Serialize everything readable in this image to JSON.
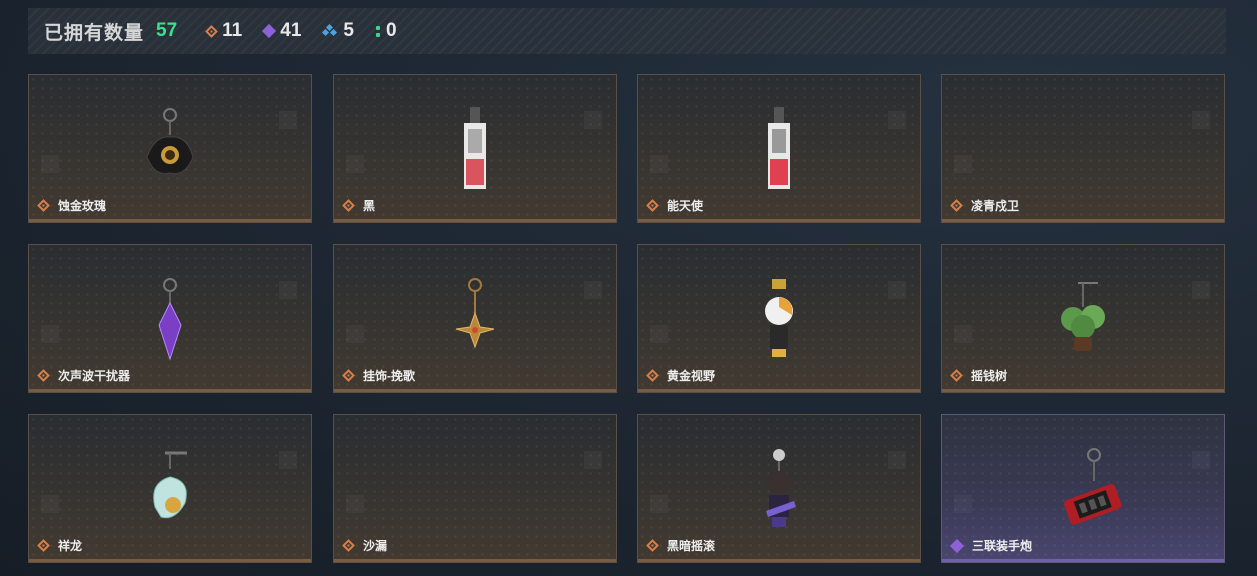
{
  "header": {
    "title": "已拥有数量",
    "total": "57",
    "stats": [
      {
        "icon": "orange-diamond-icon",
        "value": "11"
      },
      {
        "icon": "purple-diamond-icon",
        "value": "41"
      },
      {
        "icon": "blue-triangle-icon",
        "value": "5"
      },
      {
        "icon": "green-dots-icon",
        "value": "0"
      }
    ]
  },
  "colors": {
    "total": "#3fe08a",
    "rare": "#d8804a",
    "epic": "#8d62d6",
    "uncommon": "#4aa3e0",
    "common": "#3fd486"
  },
  "items": [
    {
      "name": "蚀金玫瑰",
      "rarity": "rare",
      "charm": "black-gold-rose-charm"
    },
    {
      "name": "黑",
      "rarity": "rare",
      "charm": "card-tag-charm"
    },
    {
      "name": "能天使",
      "rarity": "rare",
      "charm": "card-tag-charm"
    },
    {
      "name": "凌青戍卫",
      "rarity": "rare",
      "charm": "none"
    },
    {
      "name": "次声波干扰器",
      "rarity": "rare",
      "charm": "purple-crystal-charm"
    },
    {
      "name": "挂饰-挽歌",
      "rarity": "rare",
      "charm": "golden-star-charm"
    },
    {
      "name": "黄金视野",
      "rarity": "rare",
      "charm": "chibi-figure-charm"
    },
    {
      "name": "摇钱树",
      "rarity": "rare",
      "charm": "money-tree-charm"
    },
    {
      "name": "祥龙",
      "rarity": "rare",
      "charm": "dragon-charm"
    },
    {
      "name": "沙漏",
      "rarity": "rare",
      "charm": "none"
    },
    {
      "name": "黑暗摇滚",
      "rarity": "rare",
      "charm": "rock-figure-charm"
    },
    {
      "name": "三联装手炮",
      "rarity": "epic",
      "charm": "hand-cannon-charm"
    }
  ]
}
